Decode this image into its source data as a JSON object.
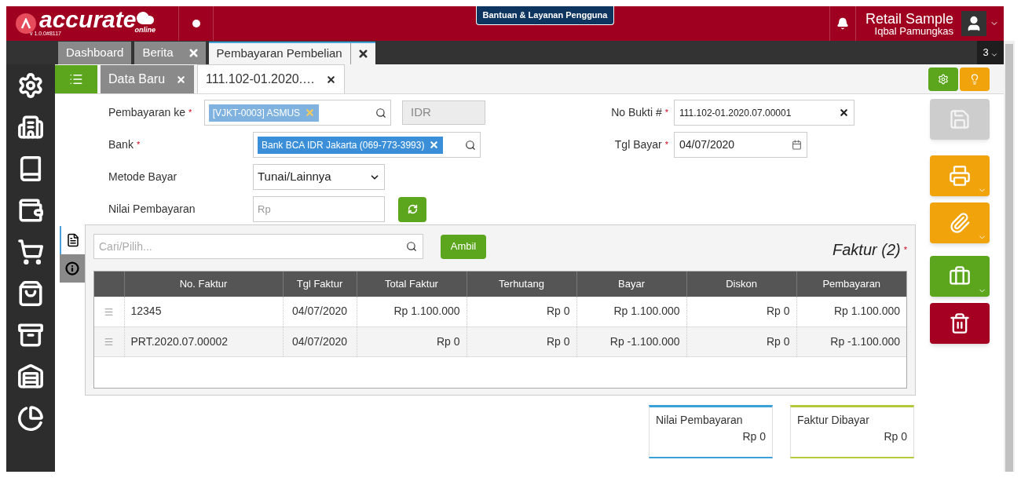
{
  "app": {
    "logo": "accurate",
    "logo_sub": "online",
    "version": "v 1.0.0#8117"
  },
  "help_button": "Bantuan & Layanan Pengguna",
  "required_mark": "*",
  "user": {
    "company": "Retail Sample",
    "name": "Iqbal Pamungkas"
  },
  "main_tabs": [
    {
      "label": "Dashboard",
      "closable": false,
      "selected": false
    },
    {
      "label": "Berita",
      "closable": true,
      "selected": false
    },
    {
      "label": "Pembayaran Pembelian",
      "closable": true,
      "selected": true
    }
  ],
  "tab_count": "3",
  "sub_tabs": [
    {
      "label": "Data Baru",
      "selected": false
    },
    {
      "label": "111.102-01.2020.…",
      "selected": true
    }
  ],
  "form_left": [
    {
      "kind": "tag",
      "label": "Pembayaran ke",
      "required": true,
      "tag": "[VJKT-0003] ASMUS",
      "faded": true,
      "currency": "IDR"
    },
    {
      "kind": "tag",
      "label": "Bank",
      "required": true,
      "tag": "Bank BCA IDR Jakarta (069-773-3993)",
      "faded": false
    },
    {
      "kind": "select",
      "label": "Metode Bayar",
      "required": false,
      "value": "Tunai/Lainnya"
    },
    {
      "kind": "amount",
      "label": "Nilai Pembayaran",
      "required": false,
      "placeholder": "Rp"
    }
  ],
  "form_right": [
    {
      "kind": "text",
      "label": "No Bukti #",
      "required": true,
      "value": "111.102-01.2020.07.00001"
    },
    {
      "kind": "date",
      "label": "Tgl Bayar",
      "required": true,
      "value": "04/07/2020"
    }
  ],
  "side_tabs": [
    {
      "kind": "list",
      "selected": true
    },
    {
      "kind": "info",
      "selected": false
    }
  ],
  "invoices": {
    "search_placeholder": "Cari/Pilih...",
    "fetch_button": "Ambil",
    "title": "Faktur (2)",
    "required": true,
    "columns": [
      "No. Faktur",
      "Tgl Faktur",
      "Total Faktur",
      "Terhutang",
      "Bayar",
      "Diskon",
      "Pembayaran"
    ],
    "rows": [
      [
        "12345",
        "04/07/2020",
        "Rp 1.100.000",
        "Rp 0",
        "Rp 1.100.000",
        "Rp 0",
        "Rp 1.100.000"
      ],
      [
        "PRT.2020.07.00002",
        "04/07/2020",
        "Rp 0",
        "Rp 0",
        "Rp -1.100.000",
        "Rp 0",
        "Rp -1.100.000"
      ]
    ]
  },
  "summary": [
    {
      "label": "Nilai Pembayaran",
      "value": "Rp 0",
      "color": "#3aa0d8"
    },
    {
      "label": "Faktur Dibayar",
      "value": "Rp 0",
      "color": "#b5c93a"
    }
  ],
  "actions": [
    {
      "kind": "save",
      "disabled": true
    },
    {
      "kind": "print",
      "disabled": false
    },
    {
      "kind": "attach",
      "disabled": false
    },
    {
      "kind": "tools",
      "disabled": false
    },
    {
      "kind": "delete",
      "disabled": false
    }
  ]
}
